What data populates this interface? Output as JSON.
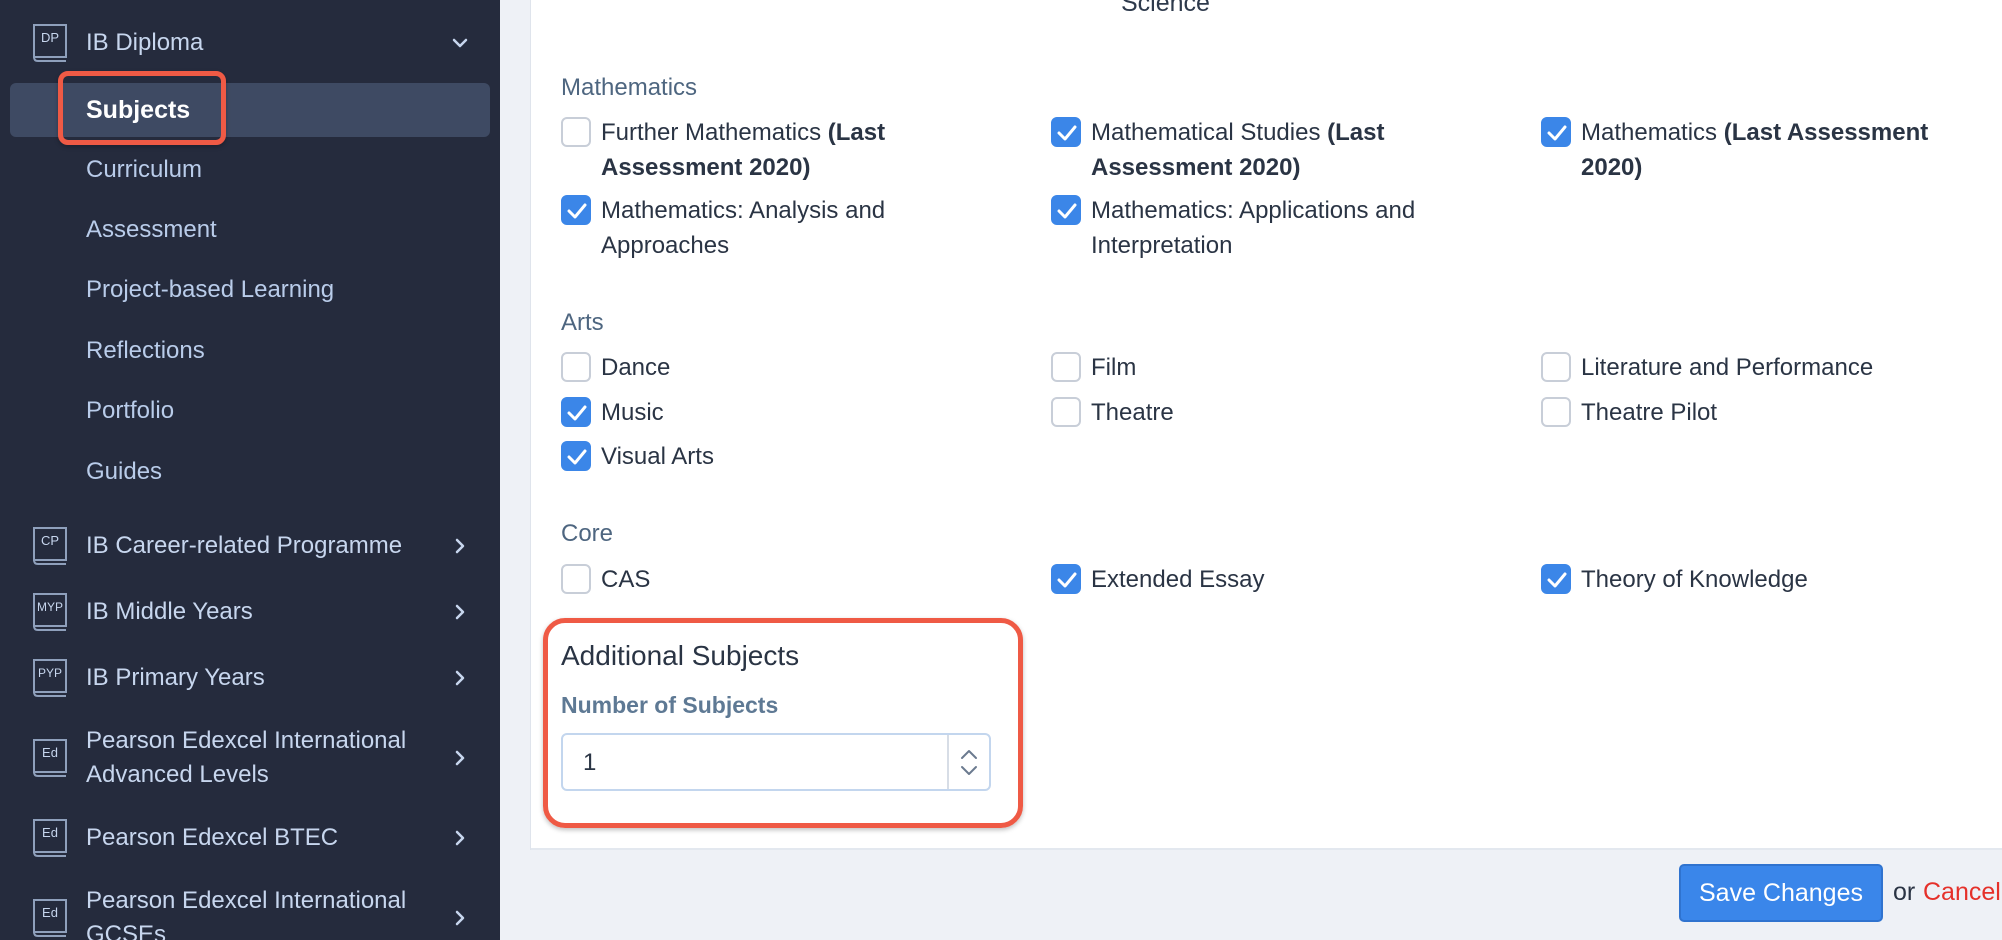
{
  "sidebar": {
    "programmes": [
      {
        "icon": "DP",
        "label": "IB Diploma",
        "expanded": true
      },
      {
        "icon": "CP",
        "label": "IB Career-related Programme"
      },
      {
        "icon": "MYP",
        "label": "IB Middle Years"
      },
      {
        "icon": "PYP",
        "label": "IB Primary Years"
      },
      {
        "icon": "Ed",
        "label": "Pearson Edexcel International Advanced Levels"
      },
      {
        "icon": "Ed",
        "label": "Pearson Edexcel BTEC"
      },
      {
        "icon": "Ed",
        "label": "Pearson Edexcel International GCSEs"
      }
    ],
    "dp_items": [
      "Subjects",
      "Curriculum",
      "Assessment",
      "Project-based Learning",
      "Reflections",
      "Portfolio",
      "Guides"
    ],
    "active_item": "Subjects"
  },
  "main": {
    "top_cut_text": "Science",
    "sections": [
      {
        "title": "Mathematics",
        "items": [
          {
            "name": "Further Mathematics",
            "note": "(Last Assessment 2020)",
            "checked": false
          },
          {
            "name": "Mathematical Studies",
            "note": "(Last Assessment 2020)",
            "checked": true
          },
          {
            "name": "Mathematics",
            "note": "(Last Assessment 2020)",
            "checked": true
          },
          {
            "name": "Mathematics: Analysis and Approaches",
            "note": "",
            "checked": true
          },
          {
            "name": "Mathematics: Applications and Interpretation",
            "note": "",
            "checked": true
          }
        ]
      },
      {
        "title": "Arts",
        "items": [
          {
            "name": "Dance",
            "checked": false
          },
          {
            "name": "Film",
            "checked": false
          },
          {
            "name": "Literature and Performance",
            "checked": false
          },
          {
            "name": "Music",
            "checked": true
          },
          {
            "name": "Theatre",
            "checked": false
          },
          {
            "name": "Theatre Pilot",
            "checked": false
          },
          {
            "name": "Visual Arts",
            "checked": true
          }
        ]
      },
      {
        "title": "Core",
        "items": [
          {
            "name": "CAS",
            "checked": false
          },
          {
            "name": "Extended Essay",
            "checked": true
          },
          {
            "name": "Theory of Knowledge",
            "checked": true
          }
        ]
      }
    ],
    "additional": {
      "title": "Additional Subjects",
      "field_label": "Number of Subjects",
      "value": "1"
    },
    "footer": {
      "save_label": "Save Changes",
      "or_text": "or",
      "cancel_label": "Cancel"
    }
  },
  "colors": {
    "sidebar_bg": "#252b3d",
    "active_bg": "#3e4a63",
    "highlight": "#ef5a45",
    "checkbox_checked": "#3b86e8",
    "primary_button": "#3a86ea",
    "cancel_link": "#e5312a"
  }
}
